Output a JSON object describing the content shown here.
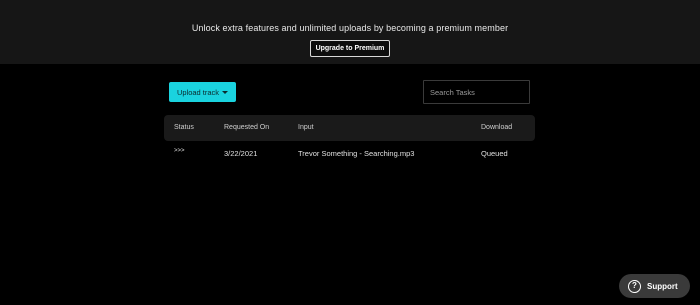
{
  "banner": {
    "text": "Unlock extra features and unlimited uploads by becoming a premium member",
    "button_label": "Upgrade to Premium"
  },
  "toolbar": {
    "upload_label": "Upload track",
    "search_placeholder": "Search Tasks"
  },
  "table": {
    "columns": [
      "Status",
      "Requested On",
      "Input",
      "Download"
    ],
    "rows": [
      {
        "status": ">>>",
        "requested_on": "3/22/2021",
        "input": "Trevor Something - Searching.mp3",
        "download": "Queued"
      }
    ]
  },
  "support": {
    "label": "Support",
    "icon": "question-circle-icon"
  },
  "colors": {
    "accent": "#1ad3df",
    "banner_bg": "#161616",
    "page_bg": "#000000",
    "table_header_bg": "#1a1a1a"
  }
}
